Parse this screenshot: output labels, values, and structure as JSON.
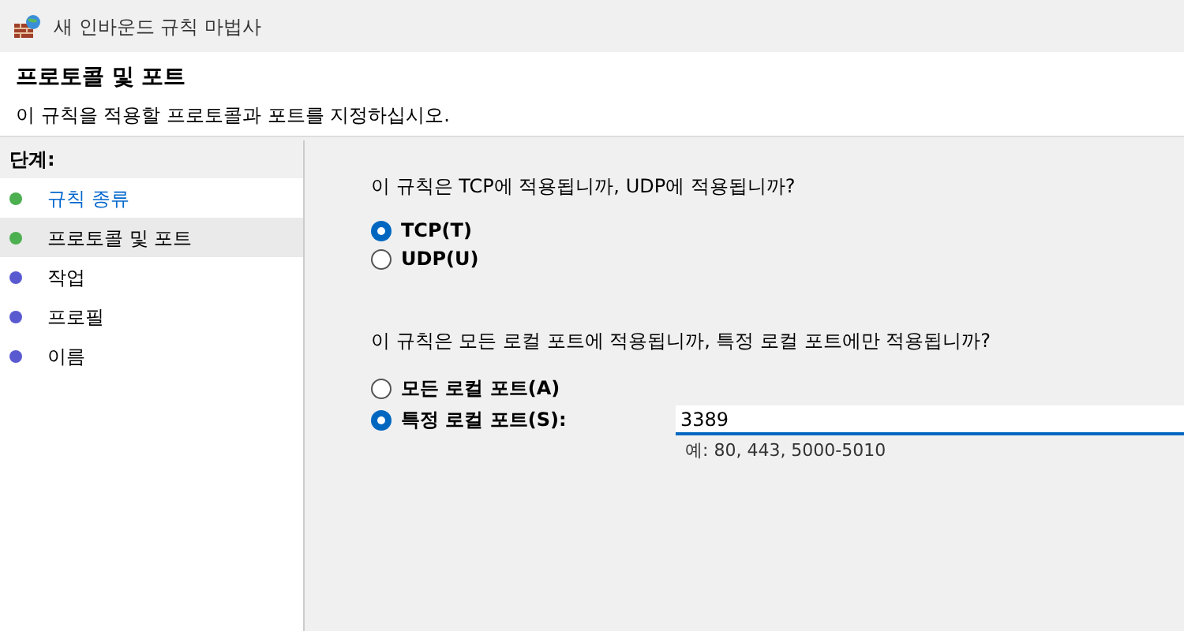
{
  "window": {
    "title": "새 인바운드 규칙 마법사"
  },
  "header": {
    "title": "프로토콜 및 포트",
    "description": "이 규칙을 적용할 프로토콜과 포트를 지정하십시오."
  },
  "steps": {
    "heading": "단계:",
    "items": [
      {
        "label": "규칙 종류",
        "color": "#4caf50",
        "selected": false,
        "link": true
      },
      {
        "label": "프로토콜 및 포트",
        "color": "#4caf50",
        "selected": true,
        "link": false
      },
      {
        "label": "작업",
        "color": "#5a5ad0",
        "selected": false,
        "link": false
      },
      {
        "label": "프로필",
        "color": "#5a5ad0",
        "selected": false,
        "link": false
      },
      {
        "label": "이름",
        "color": "#5a5ad0",
        "selected": false,
        "link": false
      }
    ]
  },
  "protocol": {
    "question": "이 규칙은 TCP에 적용됩니까, UDP에 적용됩니까?",
    "options": [
      {
        "label": "TCP(T)",
        "selected": true
      },
      {
        "label": "UDP(U)",
        "selected": false
      }
    ]
  },
  "ports": {
    "question": "이 규칙은 모든 로컬 포트에 적용됩니까, 특정 로컬 포트에만 적용됩니까?",
    "options": [
      {
        "label": "모든 로컬 포트(A)",
        "selected": false
      },
      {
        "label": "특정 로컬 포트(S):",
        "selected": true
      }
    ],
    "field": {
      "value": "3389",
      "hint": "예: 80, 443, 5000-5010"
    }
  }
}
